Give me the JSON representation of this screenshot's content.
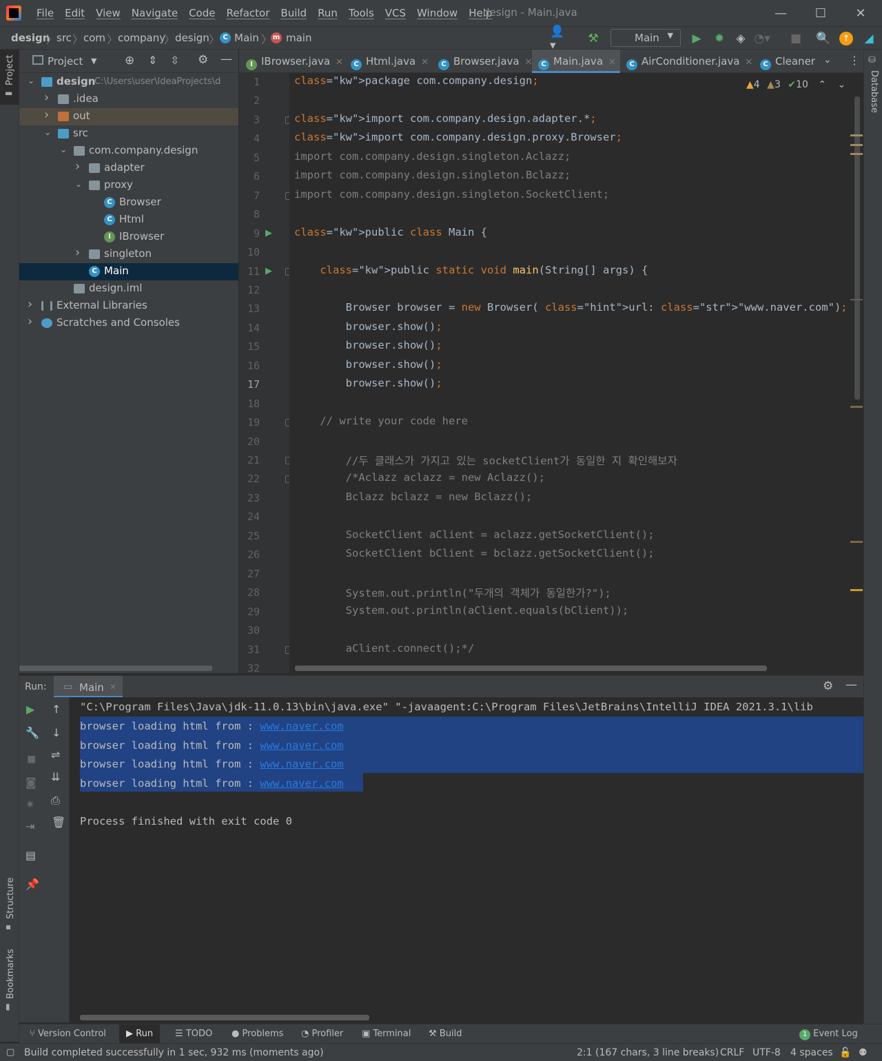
{
  "app": {
    "window_title": "design - Main.java"
  },
  "menu": [
    "File",
    "Edit",
    "View",
    "Navigate",
    "Code",
    "Refactor",
    "Build",
    "Run",
    "Tools",
    "VCS",
    "Window",
    "Help"
  ],
  "breadcrumbs": [
    "design",
    "src",
    "com",
    "company",
    "design",
    "Main",
    "main"
  ],
  "toolbar": {
    "run_config": "Main"
  },
  "project": {
    "header": "Project",
    "tree": [
      {
        "label": "design",
        "extra": "C:\\Users\\user\\IdeaProjects\\d",
        "level": 0,
        "type": "module",
        "expanded": true
      },
      {
        "label": ".idea",
        "level": 1,
        "type": "folder",
        "expanded": false
      },
      {
        "label": "out",
        "level": 1,
        "type": "folder-orange",
        "expanded": false
      },
      {
        "label": "src",
        "level": 1,
        "type": "folder-blue",
        "expanded": true
      },
      {
        "label": "com.company.design",
        "level": 2,
        "type": "package",
        "expanded": true
      },
      {
        "label": "adapter",
        "level": 3,
        "type": "package",
        "expanded": false
      },
      {
        "label": "proxy",
        "level": 3,
        "type": "package",
        "expanded": true
      },
      {
        "label": "Browser",
        "level": 4,
        "type": "class"
      },
      {
        "label": "Html",
        "level": 4,
        "type": "class"
      },
      {
        "label": "IBrowser",
        "level": 4,
        "type": "interface"
      },
      {
        "label": "singleton",
        "level": 3,
        "type": "package",
        "expanded": false
      },
      {
        "label": "Main",
        "level": 3,
        "type": "class",
        "selected": true
      },
      {
        "label": "design.iml",
        "level": 2,
        "type": "file"
      },
      {
        "label": "External Libraries",
        "level": 0,
        "type": "libs",
        "expanded": false
      },
      {
        "label": "Scratches and Consoles",
        "level": 0,
        "type": "scratch",
        "expanded": false
      }
    ]
  },
  "tabs": [
    "IBrowser.java",
    "Html.java",
    "Browser.java",
    "Main.java",
    "AirConditioner.java",
    "Cleaner"
  ],
  "inspections": {
    "warnings": "4",
    "weak_warnings": "3",
    "typos": "10"
  },
  "editor": {
    "current_line": "17",
    "lines": [
      "package com.company.design;",
      "",
      "import com.company.design.adapter.*;",
      "import com.company.design.proxy.Browser;",
      "import com.company.design.singleton.Aclazz;",
      "import com.company.design.singleton.Bclazz;",
      "import com.company.design.singleton.SocketClient;",
      "",
      "public class Main {",
      "",
      "    public static void main(String[] args) {",
      "",
      "        Browser browser = new Browser( url: \"www.naver.com\");",
      "        browser.show();",
      "        browser.show();",
      "        browser.show();",
      "        browser.show();",
      "",
      "    // write your code here",
      "",
      "        //두 클래스가 가지고 있는 socketClient가 동일한 지 확인해보자",
      "        /*Aclazz aclazz = new Aclazz();",
      "        Bclazz bclazz = new Bclazz();",
      "",
      "        SocketClient aClient = aclazz.getSocketClient();",
      "        SocketClient bClient = bclazz.getSocketClient();",
      "",
      "        System.out.println(\"두개의 객체가 동일한가?\");",
      "        System.out.println(aClient.equals(bClient));",
      "",
      "        aClient.connect();*/",
      ""
    ]
  },
  "run": {
    "label": "Run:",
    "tab": "Main",
    "command": "\"C:\\Program Files\\Java\\jdk-11.0.13\\bin\\java.exe\" \"-javaagent:C:\\Program Files\\JetBrains\\IntelliJ IDEA 2021.3.1\\lib",
    "output_prefix": "browser loading html from : ",
    "output_url": "www.naver.com",
    "exit": "Process finished with exit code 0"
  },
  "bottom_tools": [
    "Version Control",
    "Run",
    "TODO",
    "Problems",
    "Profiler",
    "Terminal",
    "Build"
  ],
  "event_log": {
    "count": "1",
    "label": "Event Log"
  },
  "status": {
    "message": "Build completed successfully in 1 sec, 932 ms (moments ago)",
    "position": "2:1 (167 chars, 3 line breaks)",
    "line_sep": "CRLF",
    "encoding": "UTF-8",
    "indent": "4 spaces"
  },
  "side": {
    "project": "Project",
    "structure": "Structure",
    "bookmarks": "Bookmarks",
    "database": "Database"
  }
}
